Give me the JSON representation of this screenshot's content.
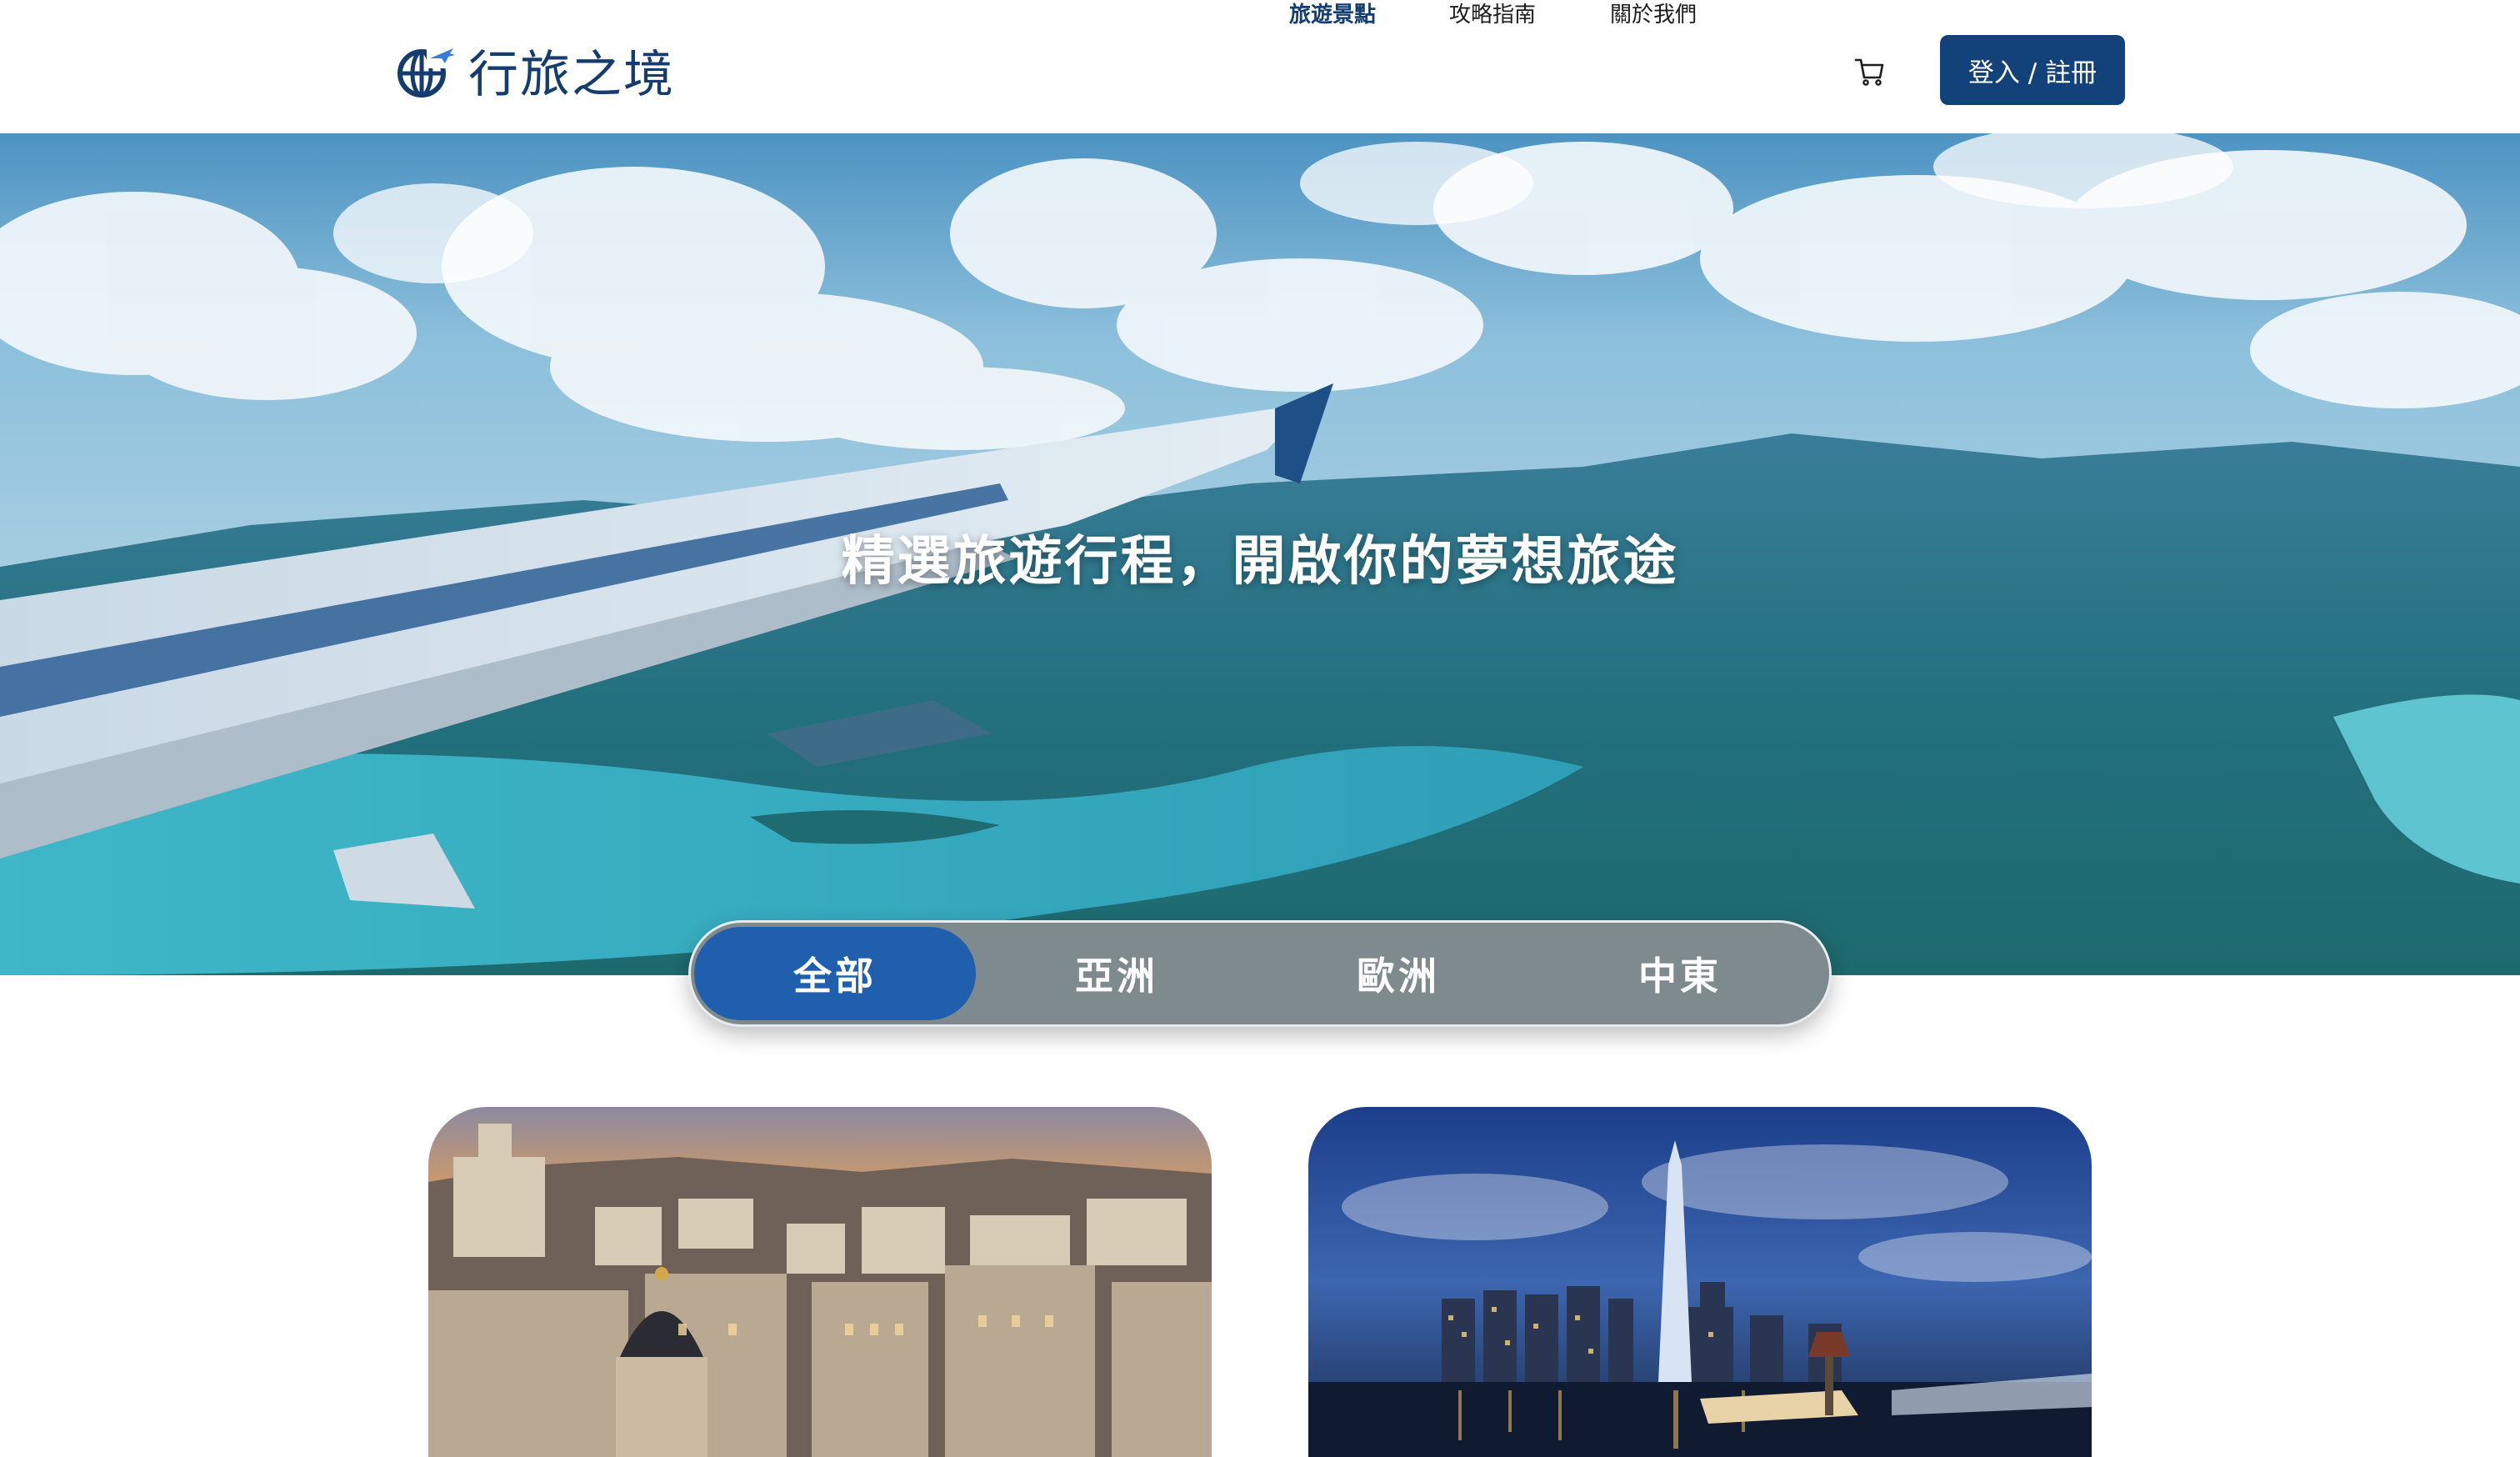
{
  "brand": {
    "name": "行旅之境",
    "logo_icon": "globe-plane-icon",
    "color": "#143c6e"
  },
  "nav": {
    "items": [
      {
        "label": "旅遊景點",
        "active": true
      },
      {
        "label": "攻略指南",
        "active": false
      },
      {
        "label": "關於我們",
        "active": false
      }
    ],
    "cart_icon": "cart-icon",
    "login_label": "登入 / 註冊"
  },
  "hero": {
    "title": "精選旅遊行程，開啟你的夢想旅途"
  },
  "filter_tabs": {
    "items": [
      {
        "label": "全部",
        "active": true
      },
      {
        "label": "亞洲",
        "active": false
      },
      {
        "label": "歐洲",
        "active": false
      },
      {
        "label": "中東",
        "active": false
      }
    ],
    "active_color": "#1f5fae"
  },
  "cards": [
    {
      "image": "city-sunset-aerial-image"
    },
    {
      "image": "city-night-skyline-image"
    }
  ]
}
